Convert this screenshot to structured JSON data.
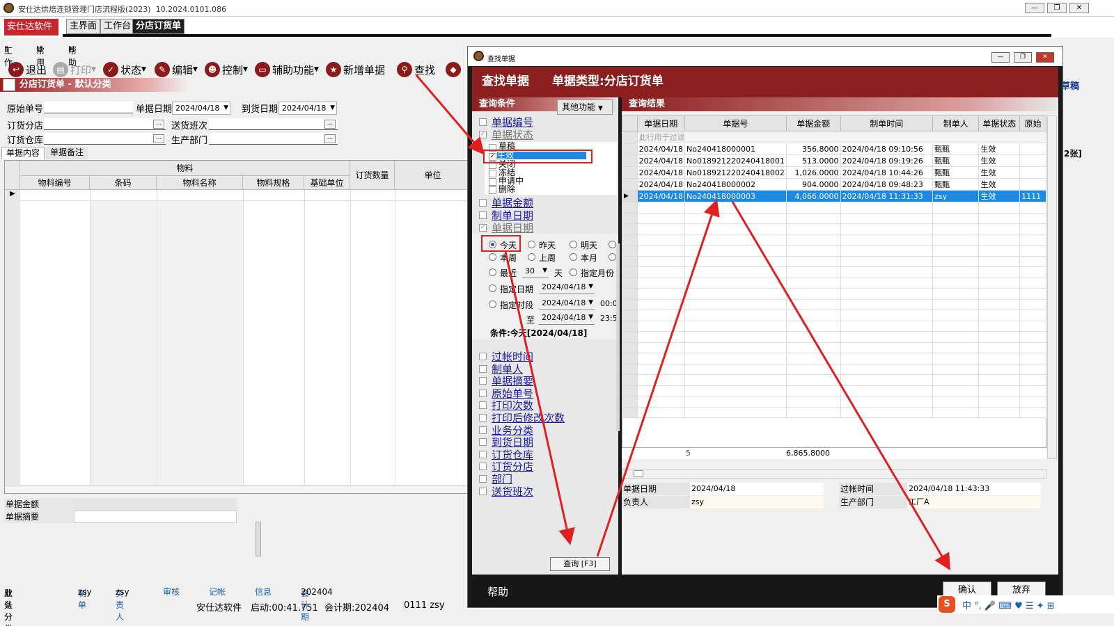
{
  "window": {
    "title": "安仕达烘焙连锁管理门店流程版(2023)",
    "version": "10.2024.0101.086"
  },
  "tabs": {
    "brand": "安仕达软件",
    "main": "主界面",
    "workbench": "工作台",
    "active": "分店订货单"
  },
  "menu": {
    "work": "工作",
    "work_key": "Ⅱ",
    "common": "常用",
    "common_key": "U",
    "help": "帮助",
    "help_key": "H"
  },
  "toolbar": {
    "exit": "退出",
    "print": "打印",
    "status": "状态",
    "edit": "编辑",
    "control": "控制",
    "aux": "辅助功能",
    "new": "新增单据",
    "find": "查找"
  },
  "form": {
    "header": "分店订货单 - 默认分类",
    "orig_no": "原始单号",
    "doc_date": "单据日期",
    "doc_date_val": "2024/04/18",
    "arrive_date": "到货日期",
    "arrive_date_val": "2024/04/18",
    "branch": "订货分店",
    "shift": "送货班次",
    "warehouse": "订货仓库",
    "dept": "生产部门",
    "tab_content": "单据内容",
    "tab_note": "单据备注",
    "grid_group": "物料",
    "order_qty": "订货数量",
    "unit": "单位",
    "cols": [
      "物料编号",
      "条码",
      "物料名称",
      "物料规格",
      "基础单位"
    ],
    "amount": "单据金额",
    "summary": "单据摘要"
  },
  "status1": {
    "category": "业务分类",
    "category_val": "默认分类",
    "maker": "制单",
    "maker_val": "zsy",
    "owner": "负责人",
    "owner_val": "zsy",
    "audit": "审核",
    "post": "记帐",
    "info": "信息",
    "period": "会计期",
    "period_val": "202404"
  },
  "status2": {
    "company": "安仕达软件",
    "start": "启动:00:41.751",
    "period": "会计期:202404",
    "user": "0111 zsy"
  },
  "dialog": {
    "title": "查找单据",
    "header_left": "查找单据",
    "header_right": "单据类型:分店订货单",
    "cond_title": "查询条件",
    "more_btn": "其他功能",
    "result_title": "查询结果",
    "conditions_top": [
      "单据编号",
      "单据状态"
    ],
    "states": [
      "草稿",
      "生效",
      "关闭",
      "冻结",
      "申请中",
      "删除"
    ],
    "conditions_mid": [
      "单据金额",
      "制单日期",
      "单据日期"
    ],
    "radios": {
      "today": "今天",
      "yesterday": "昨天",
      "tomorrow": "明天",
      "week": "本周",
      "lastweek": "上周",
      "month": "本月",
      "recent": "最近",
      "recent_val": "30",
      "days": "天",
      "spec_month": "指定月份",
      "spec_date": "指定日期",
      "spec_date_val": "2024/04/18",
      "spec_range": "指定时段",
      "range_from": "2024/04/18",
      "range_from_time": "00:0",
      "to": "至",
      "range_to": "2024/04/18",
      "range_to_time": "23:5"
    },
    "condition_summary": "条件:今天[2024/04/18]",
    "conditions_bottom": [
      "过帐时间",
      "制单人",
      "单据摘要",
      "原始单号",
      "打印次数",
      "打印后修改次数",
      "业务分类",
      "到货日期",
      "订货仓库",
      "订货分店",
      "部门",
      "送货班次"
    ],
    "query_btn": "查询 [F3]",
    "result_cols": [
      "单据日期",
      "单据号",
      "单据金额",
      "制单时间",
      "制单人",
      "单据状态",
      "原始"
    ],
    "filter_hint": "此行用于过滤",
    "rows": [
      {
        "date": "2024/04/18",
        "no": "No240418000001",
        "amount": "356.8000",
        "time": "2024/04/18 09:10:56",
        "maker": "甄甄",
        "state": "生效",
        "orig": ""
      },
      {
        "date": "2024/04/18",
        "no": "No018921220240418001",
        "amount": "513.0000",
        "time": "2024/04/18 09:19:26",
        "maker": "甄甄",
        "state": "生效",
        "orig": ""
      },
      {
        "date": "2024/04/18",
        "no": "No018921220240418002",
        "amount": "1,026.0000",
        "time": "2024/04/18 10:44:26",
        "maker": "甄甄",
        "state": "生效",
        "orig": ""
      },
      {
        "date": "2024/04/18",
        "no": "No240418000002",
        "amount": "904.0000",
        "time": "2024/04/18 09:48:23",
        "maker": "甄甄",
        "state": "生效",
        "orig": ""
      },
      {
        "date": "2024/04/18",
        "no": "No240418000003",
        "amount": "4,066.0000",
        "time": "2024/04/18 11:31:33",
        "maker": "zsy",
        "state": "生效",
        "orig": "1111"
      }
    ],
    "total_count": "5",
    "total_amount": "6,865.8000",
    "detail": {
      "doc_date": "单据日期",
      "doc_date_val": "2024/04/18",
      "post_time": "过帐时间",
      "post_time_val": "2024/04/18 11:43:33",
      "owner": "负责人",
      "owner_val": "zsy",
      "dept": "生产部门",
      "dept_val": "工厂A"
    },
    "help": "帮助",
    "ok": "确认",
    "cancel": "放弃"
  },
  "side": {
    "draft": "草稿",
    "count": "2张]"
  },
  "colors": {
    "brand_red": "#c8262b",
    "header_red": "#8b1e1e",
    "select_blue": "#1e88e5",
    "annot_red": "#e02020"
  }
}
